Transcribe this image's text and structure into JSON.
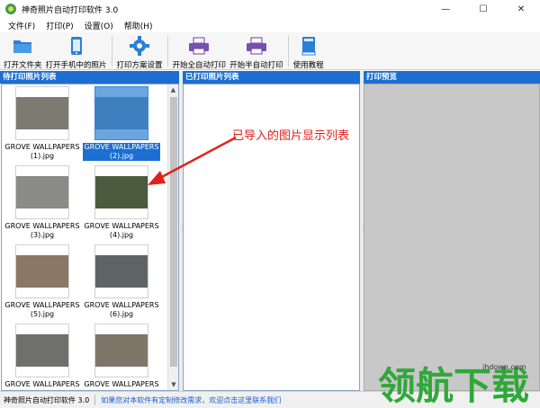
{
  "window": {
    "title": "神奇照片自动打印软件 3.0",
    "controls": [
      "—",
      "☐",
      "✕"
    ]
  },
  "menu": [
    "文件(F)",
    "打印(P)",
    "设置(O)",
    "帮助(H)"
  ],
  "toolbar": {
    "open_folder": "打开文件夹",
    "open_phone": "打开手机中的照片",
    "print_scheme": "打印方案设置",
    "start_full_auto": "开始全自动打印",
    "start_semi_auto": "开始半自动打印",
    "tutorial": "使用教程"
  },
  "panes": {
    "pending": "待打印照片列表",
    "printed": "已打印照片列表",
    "preview": "打印预览"
  },
  "thumbnails": [
    {
      "label": "GROVE WALLPAPERS (1).jpg",
      "l1": "GROVE WALLPAPERS",
      "l2": "(1).jpg",
      "selected": false,
      "color": "#7d7a72"
    },
    {
      "label": "GROVE WALLPAPERS (2).jpg",
      "l1": "GROVE WALLPAPERS",
      "l2": "(2).jpg",
      "selected": true,
      "color": "#3e7fbf"
    },
    {
      "label": "GROVE WALLPAPERS (3).jpg",
      "l1": "GROVE WALLPAPERS",
      "l2": "(3).jpg",
      "selected": false,
      "color": "#8a8b86"
    },
    {
      "label": "GROVE WALLPAPERS (4).jpg",
      "l1": "GROVE WALLPAPERS",
      "l2": "(4).jpg",
      "selected": false,
      "color": "#4c5a3e"
    },
    {
      "label": "GROVE WALLPAPERS (5).jpg",
      "l1": "GROVE WALLPAPERS",
      "l2": "(5).jpg",
      "selected": false,
      "color": "#8a7864"
    },
    {
      "label": "GROVE WALLPAPERS (6).jpg",
      "l1": "GROVE WALLPAPERS",
      "l2": "(6).jpg",
      "selected": false,
      "color": "#5e6466"
    },
    {
      "label": "GROVE WALLPAPERS",
      "l1": "GROVE WALLPAPERS",
      "l2": "",
      "selected": false,
      "color": "#6f6f6d"
    },
    {
      "label": "GROVE WALLPAPERS",
      "l1": "GROVE WALLPAPERS",
      "l2": "",
      "selected": false,
      "color": "#7f766a"
    }
  ],
  "annotation": "已导入的图片显示列表",
  "status": {
    "app": "神奇照片自动打印软件 3.0",
    "notice": "如果您对本软件有定制修改需求，欢迎点击这里联系我们"
  },
  "watermark": {
    "site": "ihdown.com",
    "brand": "领航下载"
  },
  "colors": {
    "header_blue": "#1c6fd1",
    "annotation_red": "#e2201c",
    "watermark_green": "#2fa83a"
  }
}
